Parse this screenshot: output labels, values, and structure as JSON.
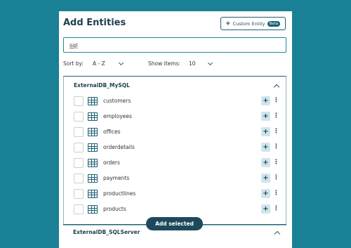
{
  "title": "Add Entities",
  "custom_entity": {
    "label": "Custom Entity",
    "badge": "Beta"
  },
  "search": {
    "value": "sql"
  },
  "sort": {
    "label": "Sort by:",
    "value": "A - Z"
  },
  "show": {
    "label": "Show items:",
    "value": "10"
  },
  "groups": [
    {
      "title": "ExternalDB_MySQL",
      "items": [
        "customers",
        "employees",
        "offices",
        "orderdetails",
        "orders",
        "payments",
        "productlines",
        "products"
      ]
    },
    {
      "title": "ExternalDB_SQLServer"
    }
  ],
  "add_selected": "Add selected",
  "colors": {
    "background": "#1a8095",
    "accent": "#1d5f74",
    "button_dark": "#1d4a5b"
  }
}
